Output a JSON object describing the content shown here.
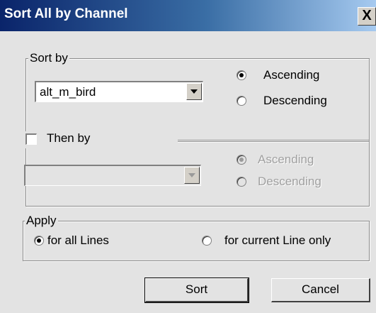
{
  "window": {
    "title": "Sort All by Channel",
    "close_glyph": "X"
  },
  "sort_by": {
    "legend": "Sort by",
    "field_value": "alt_m_bird",
    "ascending_label": "Ascending",
    "descending_label": "Descending",
    "selected": "Ascending"
  },
  "then_by": {
    "label": "Then by",
    "checked": false,
    "field_value": "",
    "ascending_label": "Ascending",
    "descending_label": "Descending",
    "selected": "Ascending",
    "enabled": false
  },
  "apply": {
    "legend": "Apply",
    "all_lines_label": "for all Lines",
    "current_line_label": "for current Line only",
    "selected": "for all Lines"
  },
  "buttons": {
    "sort_label": "Sort",
    "cancel_label": "Cancel"
  },
  "icons": {
    "close": "close-icon",
    "dropdown_arrow": "chevron-down-icon"
  },
  "colors": {
    "title_bar_start": "#0a246a",
    "title_bar_end": "#a6caf0",
    "dialog_background": "#e3e3e3",
    "disabled_text": "#a0a0a0"
  }
}
